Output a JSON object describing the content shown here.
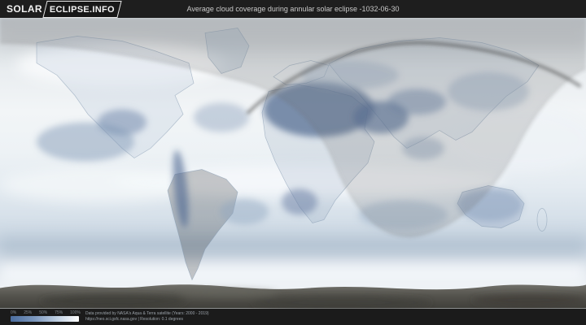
{
  "header": {
    "logo_part1": "SOLAR",
    "logo_part2": "ECLIPSE.INFO",
    "title": "Average cloud coverage during annular solar eclipse -1032-06-30"
  },
  "legend": {
    "ticks": [
      "0%",
      "25%",
      "50%",
      "75%",
      "100%"
    ],
    "gradient_start": "#4b6da0",
    "gradient_end": "#ffffff"
  },
  "footer": {
    "attribution_line1": "Data provided by NASA's Aqua & Terra satellite (Years: 2000 - 2019)",
    "attribution_line2": "https://neo.sci.gsfc.nasa.gov | Resolution: 0.1 degrees"
  }
}
